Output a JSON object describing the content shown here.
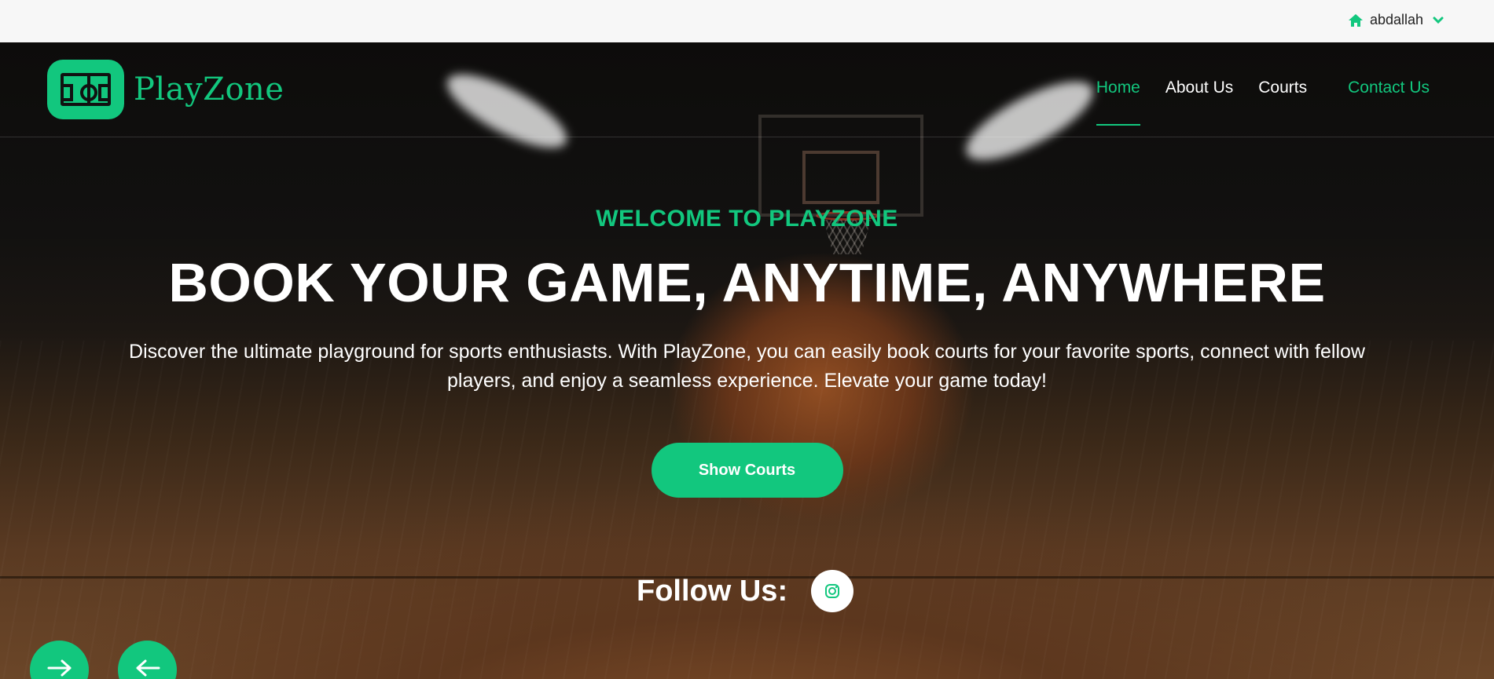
{
  "topbar": {
    "username": "abdallah",
    "home_icon": "home-icon",
    "chevron_icon": "chevron-down-icon"
  },
  "brand": {
    "name": "PlayZone"
  },
  "nav": {
    "home": "Home",
    "about": "About Us",
    "courts": "Courts",
    "contact": "Contact Us"
  },
  "hero": {
    "eyebrow": "WELCOME TO PLAYZONE",
    "headline": "BOOK YOUR GAME, ANYTIME, ANYWHERE",
    "lead": "Discover the ultimate playground for sports enthusiasts. With PlayZone, you can easily book courts for your favorite sports, connect with fellow players, and enjoy a seamless experience. Elevate your game today!",
    "cta": "Show Courts",
    "follow_label": "Follow Us:"
  },
  "colors": {
    "accent": "#12c77e",
    "topbar": "#f7f7f7",
    "text_light": "#ffffff"
  }
}
